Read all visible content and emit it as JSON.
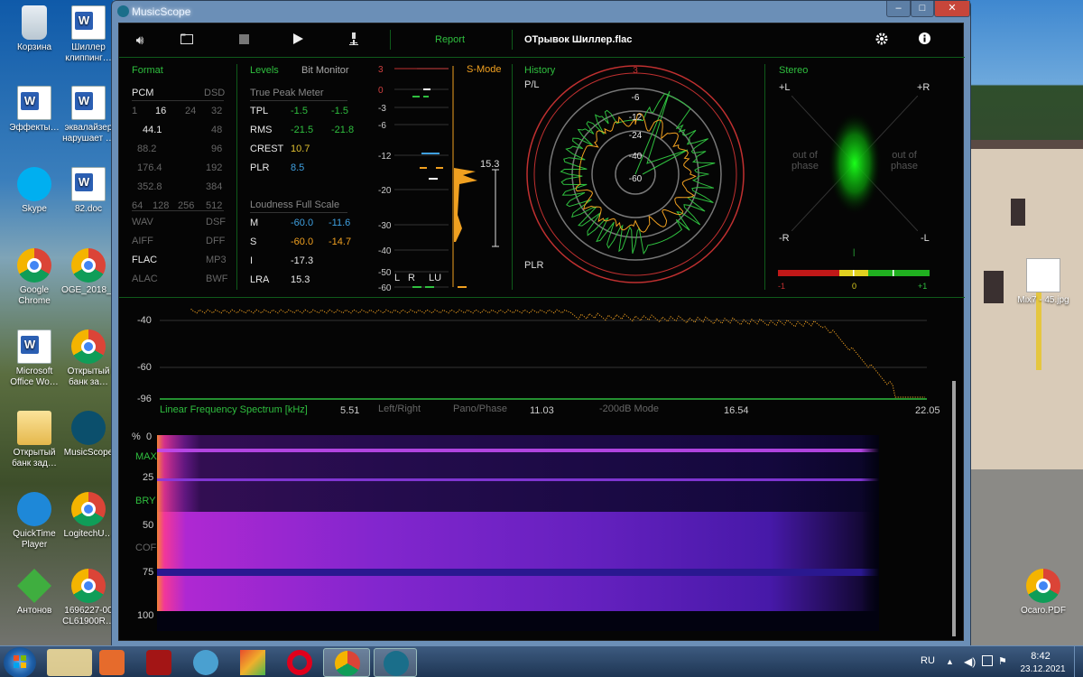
{
  "desktop": {
    "icons": [
      {
        "label": "Корзина",
        "icon": "recycle-bin-icon"
      },
      {
        "label": "Шиллер клиппинг…",
        "icon": "app-icon"
      },
      {
        "label": "Эффекты…",
        "icon": "word-doc-icon"
      },
      {
        "label": "эквалайзер нарушает …",
        "icon": "word-doc-icon"
      },
      {
        "label": "Skype",
        "icon": "skype-icon"
      },
      {
        "label": "82.doc",
        "icon": "word-doc-icon"
      },
      {
        "label": "Google Chrome",
        "icon": "chrome-icon"
      },
      {
        "label": "OGE_2018_…",
        "icon": "chrome-icon"
      },
      {
        "label": "Microsoft Office Wo…",
        "icon": "word-icon"
      },
      {
        "label": "Открытый банк за…",
        "icon": "chrome-icon"
      },
      {
        "label": "Открытый банк зад…",
        "icon": "folder-icon"
      },
      {
        "label": "MusicScope",
        "icon": "musicscope-icon"
      },
      {
        "label": "QuickTime Player",
        "icon": "quicktime-icon"
      },
      {
        "label": "LogitechU…",
        "icon": "chrome-icon"
      },
      {
        "label": "Антонов",
        "icon": "green-icon"
      },
      {
        "label": "1696227-00 CL61900R…",
        "icon": "chrome-icon"
      },
      {
        "label": "Mix7 - 45.jpg",
        "icon": "image-icon"
      },
      {
        "label": "Ocaro.PDF",
        "icon": "chrome-icon"
      }
    ]
  },
  "window": {
    "title": "MusicScope",
    "min": "–",
    "max": "□",
    "close": "✕"
  },
  "toolbar": {
    "report": "Report",
    "filename": "ОТрывок Шиллер.flac"
  },
  "format": {
    "title": "Format",
    "pcm": "PCM",
    "dsd": "DSD",
    "bits": [
      "1",
      "16",
      "24",
      "32"
    ],
    "rates_left": [
      "44.1",
      "88.2",
      "176.4",
      "352.8"
    ],
    "rates_right": [
      "48",
      "96",
      "192",
      "384"
    ],
    "dsd_rates": [
      "64",
      "128",
      "256",
      "512"
    ],
    "types_left": [
      "WAV",
      "AIFF",
      "FLAC",
      "ALAC"
    ],
    "types_right": [
      "DSF",
      "DFF",
      "MP3",
      "BWF"
    ]
  },
  "levels": {
    "title": "Levels",
    "bit_monitor": "Bit Monitor",
    "tpm_title": "True Peak Meter",
    "rows": [
      {
        "name": "TPL",
        "l": "-1.5",
        "r": "-1.5"
      },
      {
        "name": "RMS",
        "l": "-21.5",
        "r": "-21.8"
      },
      {
        "name": "CREST",
        "l": "10.7",
        "r": ""
      },
      {
        "name": "PLR",
        "l": "8.5",
        "r": ""
      }
    ],
    "lfs_title": "Loudness Full Scale",
    "lfs": [
      {
        "name": "M",
        "a": "-60.0",
        "b": "-11.6"
      },
      {
        "name": "S",
        "a": "-60.0",
        "b": "-14.7"
      },
      {
        "name": "I",
        "a": "-17.3",
        "b": ""
      },
      {
        "name": "LRA",
        "a": "15.3",
        "b": ""
      }
    ]
  },
  "meter": {
    "scale": [
      "3",
      "0",
      "-3",
      "-6",
      "-12",
      "-20",
      "-30",
      "-40",
      "-50",
      "-60"
    ],
    "smode": "S-Mode",
    "lra": "15.3",
    "l": "L",
    "r": "R",
    "lu": "LU"
  },
  "history": {
    "title": "History",
    "pl": "P/L",
    "plr": "PLR",
    "rings": [
      "3",
      "-6",
      "-12",
      "-24",
      "-40",
      "-60"
    ]
  },
  "stereo": {
    "title": "Stereo",
    "pl": "+L",
    "pr": "+R",
    "ml": "-R",
    "mr": "-L",
    "oop_left": "out of phase",
    "oop_right": "out of phase",
    "corr": [
      "-1",
      "0",
      "+1"
    ]
  },
  "spectrum": {
    "y": [
      "-40",
      "-60",
      "-96"
    ],
    "title": "Linear Frequency Spectrum [kHz]",
    "x": [
      "5.51",
      "11.03",
      "16.54",
      "22.05"
    ],
    "modes": [
      "Left/Right",
      "Pano/Phase",
      "-200dB Mode"
    ]
  },
  "sono": {
    "labels": [
      "%",
      "0",
      "MAX",
      "25",
      "BRY",
      "50",
      "COF",
      "75",
      "100"
    ]
  },
  "taskbar": {
    "lang": "RU",
    "time": "8:42",
    "date": "23.12.2021"
  }
}
